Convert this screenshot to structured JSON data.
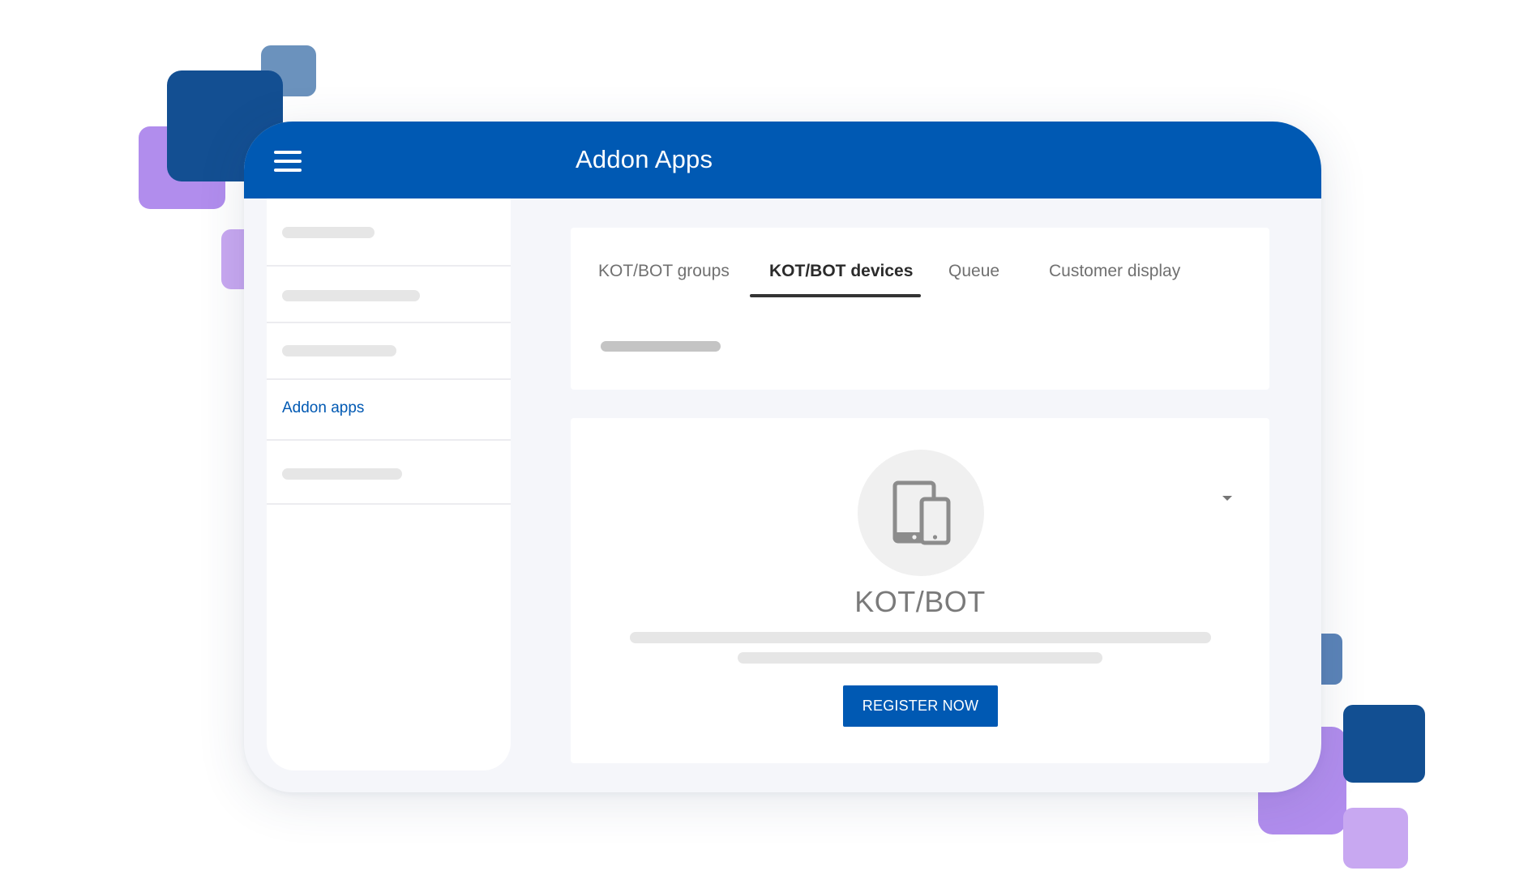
{
  "app": {
    "title": "Addon Apps"
  },
  "icons": {
    "menu": "hamburger-menu-icon",
    "devices": "tablet-phone-devices-icon",
    "dropdown": "caret-down-icon"
  },
  "colors": {
    "brand": "#0059b3",
    "active_tab": "#2b2b2b",
    "inactive_tab": "#707070",
    "background": "#f5f6fa"
  },
  "sidebar": {
    "items": [
      {
        "label": "",
        "placeholder": true
      },
      {
        "label": "",
        "placeholder": true
      },
      {
        "label": "",
        "placeholder": true
      },
      {
        "label": "Addon apps",
        "placeholder": false,
        "active": true
      },
      {
        "label": "",
        "placeholder": true
      }
    ]
  },
  "tabs": [
    {
      "label": "KOT/BOT groups",
      "active": false
    },
    {
      "label": "KOT/BOT devices",
      "active": true
    },
    {
      "label": "Queue",
      "active": false
    },
    {
      "label": "Customer display",
      "active": false
    }
  ],
  "content": {
    "title": "KOT/BOT",
    "register_label": "REGISTER NOW"
  }
}
